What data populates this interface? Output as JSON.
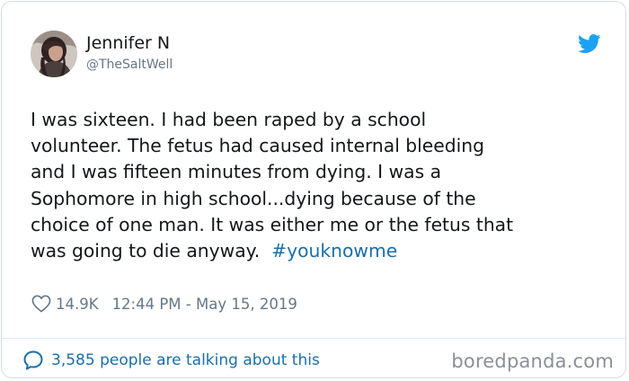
{
  "author": {
    "name": "Jennifer N",
    "handle": "@TheSaltWell"
  },
  "tweet": {
    "lines": [
      "I was sixteen. I had been raped by a school",
      "volunteer. The fetus had caused internal bleeding",
      "and I was fifteen minutes from dying. I was a",
      "Sophomore in high school...dying because of the",
      "choice of one man. It was either me or the fetus that"
    ],
    "last_line_text": "was going to die anyway.",
    "hashtag": "#youknowme"
  },
  "meta": {
    "likes": "14.9K",
    "timestamp": "12:44 PM - May 15, 2019"
  },
  "footer": {
    "talking": "3,585 people are talking about this"
  },
  "watermark": "boredpanda.com",
  "icons": {
    "twitter_bird": "twitter-bird-icon",
    "heart": "heart-icon",
    "conversation": "speech-bubble-icon"
  },
  "colors": {
    "text": "#14171a",
    "secondary": "#657786",
    "link": "#1b6fa8",
    "twitter_blue": "#1da1f2",
    "border": "#d6dde3"
  }
}
